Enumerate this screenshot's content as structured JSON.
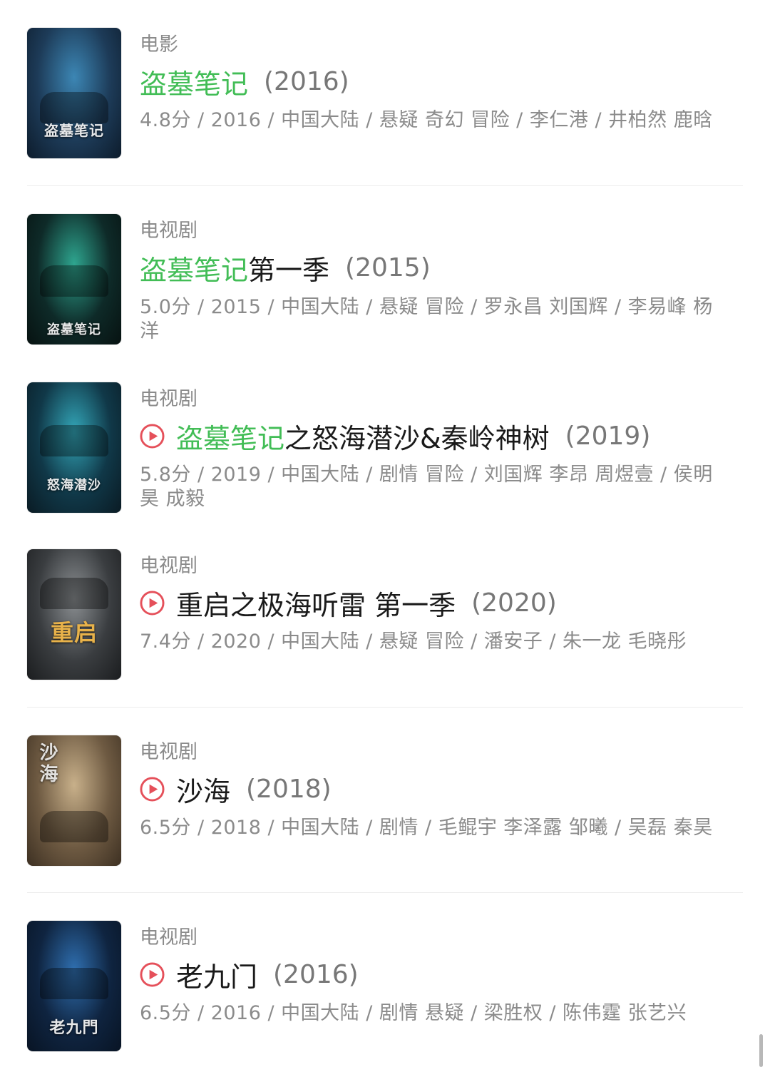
{
  "results": [
    {
      "category": "电影",
      "has_play": false,
      "title_match": "盗墓笔记",
      "title_rest": "",
      "year": "(2016)",
      "meta": "4.8分 / 2016 / 中国大陆 / 悬疑 奇幻 冒险 / 李仁港 / 井柏然 鹿晗",
      "poster_text": "盗墓笔记",
      "poster_colors": [
        "#1d3b58",
        "#3c86b4",
        "#0d1c2c"
      ]
    },
    {
      "category": "电视剧",
      "has_play": false,
      "title_match": "盗墓笔记",
      "title_rest": " 第一季",
      "year": "(2015)",
      "meta": "5.0分 / 2015 / 中国大陆 / 悬疑 冒险 / 罗永昌 刘国辉 / 李易峰 杨洋",
      "poster_text": "盗墓笔记",
      "poster_colors": [
        "#0e2a28",
        "#2ea58f",
        "#071211"
      ]
    },
    {
      "category": "电视剧",
      "has_play": true,
      "title_match": "盗墓笔记",
      "title_rest": "之怒海潜沙&秦岭神树",
      "year": "(2019)",
      "meta": "5.8分 / 2019 / 中国大陆 / 剧情 冒险 / 刘国辉 李昂 周煜壹 / 侯明昊 成毅",
      "poster_text": "怒海潜沙",
      "poster_colors": [
        "#103848",
        "#33a6b8",
        "#0a1b24"
      ]
    },
    {
      "category": "电视剧",
      "has_play": true,
      "title_match": "",
      "title_rest": "重启之极海听雷 第一季",
      "year": "(2020)",
      "meta": "7.4分 / 2020 / 中国大陆 / 悬疑 冒险 / 潘安子 / 朱一龙 毛晓彤",
      "poster_text": "重启",
      "poster_colors": [
        "#3a3d40",
        "#8b8f92",
        "#1b1d1f"
      ]
    },
    {
      "category": "电视剧",
      "has_play": true,
      "title_match": "",
      "title_rest": "沙海",
      "year": "(2018)",
      "meta": "6.5分 / 2018 / 中国大陆 / 剧情 / 毛鲲宇 李泽露 邹曦 / 吴磊 秦昊",
      "poster_text": "沙海",
      "poster_colors": [
        "#6e5a42",
        "#c8b08a",
        "#3d3022"
      ]
    },
    {
      "category": "电视剧",
      "has_play": true,
      "title_match": "",
      "title_rest": "老九门",
      "year": "(2016)",
      "meta": "6.5分 / 2016 / 中国大陆 / 剧情 悬疑 / 梁胜权 / 陈伟霆 张艺兴",
      "poster_text": "老九門",
      "poster_colors": [
        "#0f2440",
        "#2f6fb0",
        "#081424"
      ]
    }
  ]
}
